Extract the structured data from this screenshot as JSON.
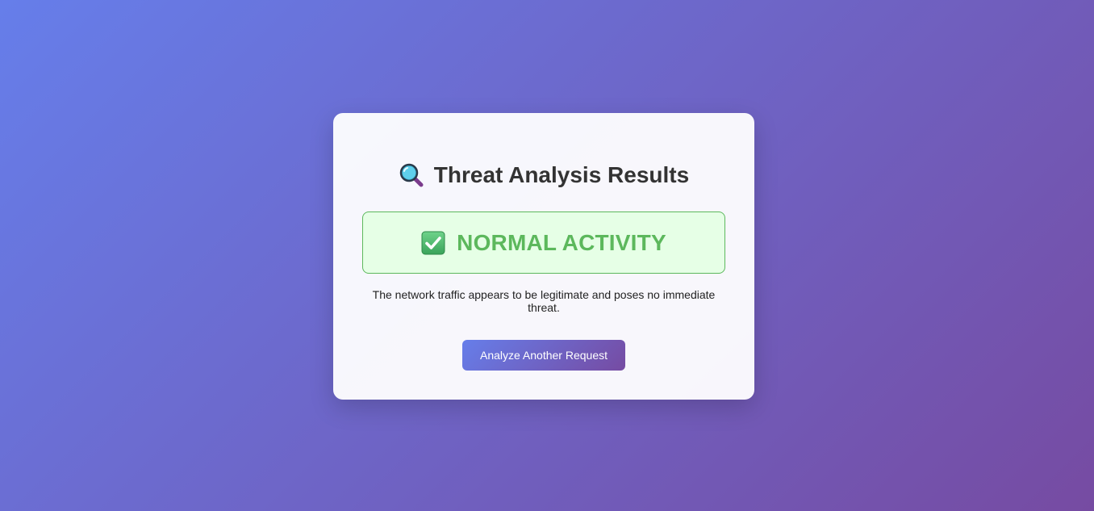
{
  "result_card": {
    "title": "Threat Analysis Results",
    "title_icon": "magnifying-glass-icon",
    "status": {
      "icon": "check-mark-button-icon",
      "label": "NORMAL ACTIVITY",
      "color": "#5cb85c",
      "background": "#e6ffe6"
    },
    "description": "The network traffic appears to be legitimate and poses no immediate threat.",
    "action_button_label": "Analyze Another Request"
  },
  "theme": {
    "gradient_start": "#667eea",
    "gradient_end": "#764ba2",
    "title_color": "#333333"
  }
}
